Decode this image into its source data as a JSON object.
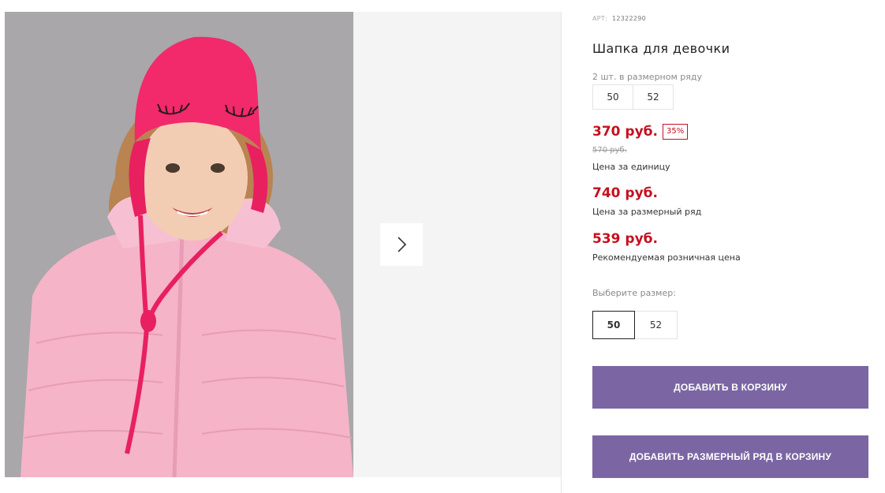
{
  "product": {
    "sku_label": "АРТ:",
    "sku_value": "12322290",
    "title": "Шапка для девочки",
    "pack_note": "2 шт. в размерном ряду",
    "pack_sizes": [
      "50",
      "52"
    ]
  },
  "prices": {
    "unit_price": "370 руб.",
    "discount_badge": "35%",
    "old_price": "570 руб.",
    "unit_note": "Цена за единицу",
    "row_price": "740 руб.",
    "row_note": "Цена за размерный ряд",
    "retail_price": "539 руб.",
    "retail_note": "Рекомендуемая розничная цена"
  },
  "size_select": {
    "label": "Выберите размер:",
    "options": [
      "50",
      "52"
    ],
    "selected": "50"
  },
  "buttons": {
    "add_to_cart": "ДОБАВИТЬ В КОРЗИНУ",
    "add_row_to_cart": "ДОБАВИТЬ РАЗМЕРНЫЙ РЯД В КОРЗИНУ"
  },
  "colors": {
    "price_red": "#c4101f",
    "button_purple": "#7b66a3",
    "hat": "#f2296b",
    "jacket": "#f5b4c8"
  },
  "gallery": {
    "photo_subject": "girl-in-pink-hat-and-jacket"
  }
}
